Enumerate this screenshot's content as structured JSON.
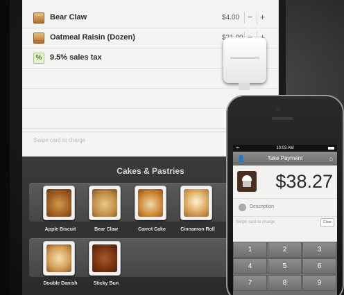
{
  "cart": {
    "items": [
      {
        "name": "Bear Claw",
        "price": "$4.00"
      },
      {
        "name": "Oatmeal Raisin (Dozen)",
        "price": "$21.00"
      },
      {
        "name": "9.5% sales tax",
        "icon": "%"
      }
    ],
    "swipe_hint": "Swipe card to charge"
  },
  "category": {
    "title": "Cakes & Pastries",
    "products": [
      {
        "label": "Apple Biscuit"
      },
      {
        "label": "Bear Claw"
      },
      {
        "label": "Carrot Cake"
      },
      {
        "label": "Cinnamon Roll"
      },
      {
        "label": "Double Danish"
      },
      {
        "label": "Sticky Bun"
      }
    ]
  },
  "phone": {
    "time": "10:03 AM",
    "title": "Take Payment",
    "amount": "$38.27",
    "description_placeholder": "Description",
    "swipe_hint": "Swipe card to charge",
    "clear_label": "Clear",
    "keys": [
      "1",
      "2",
      "3",
      "4",
      "5",
      "6",
      "7",
      "8",
      "9"
    ]
  },
  "colors": {
    "ipad_background": "#f4f4f2",
    "shelf": "#4e4e4e",
    "titlebar": "#7c7c7c"
  }
}
